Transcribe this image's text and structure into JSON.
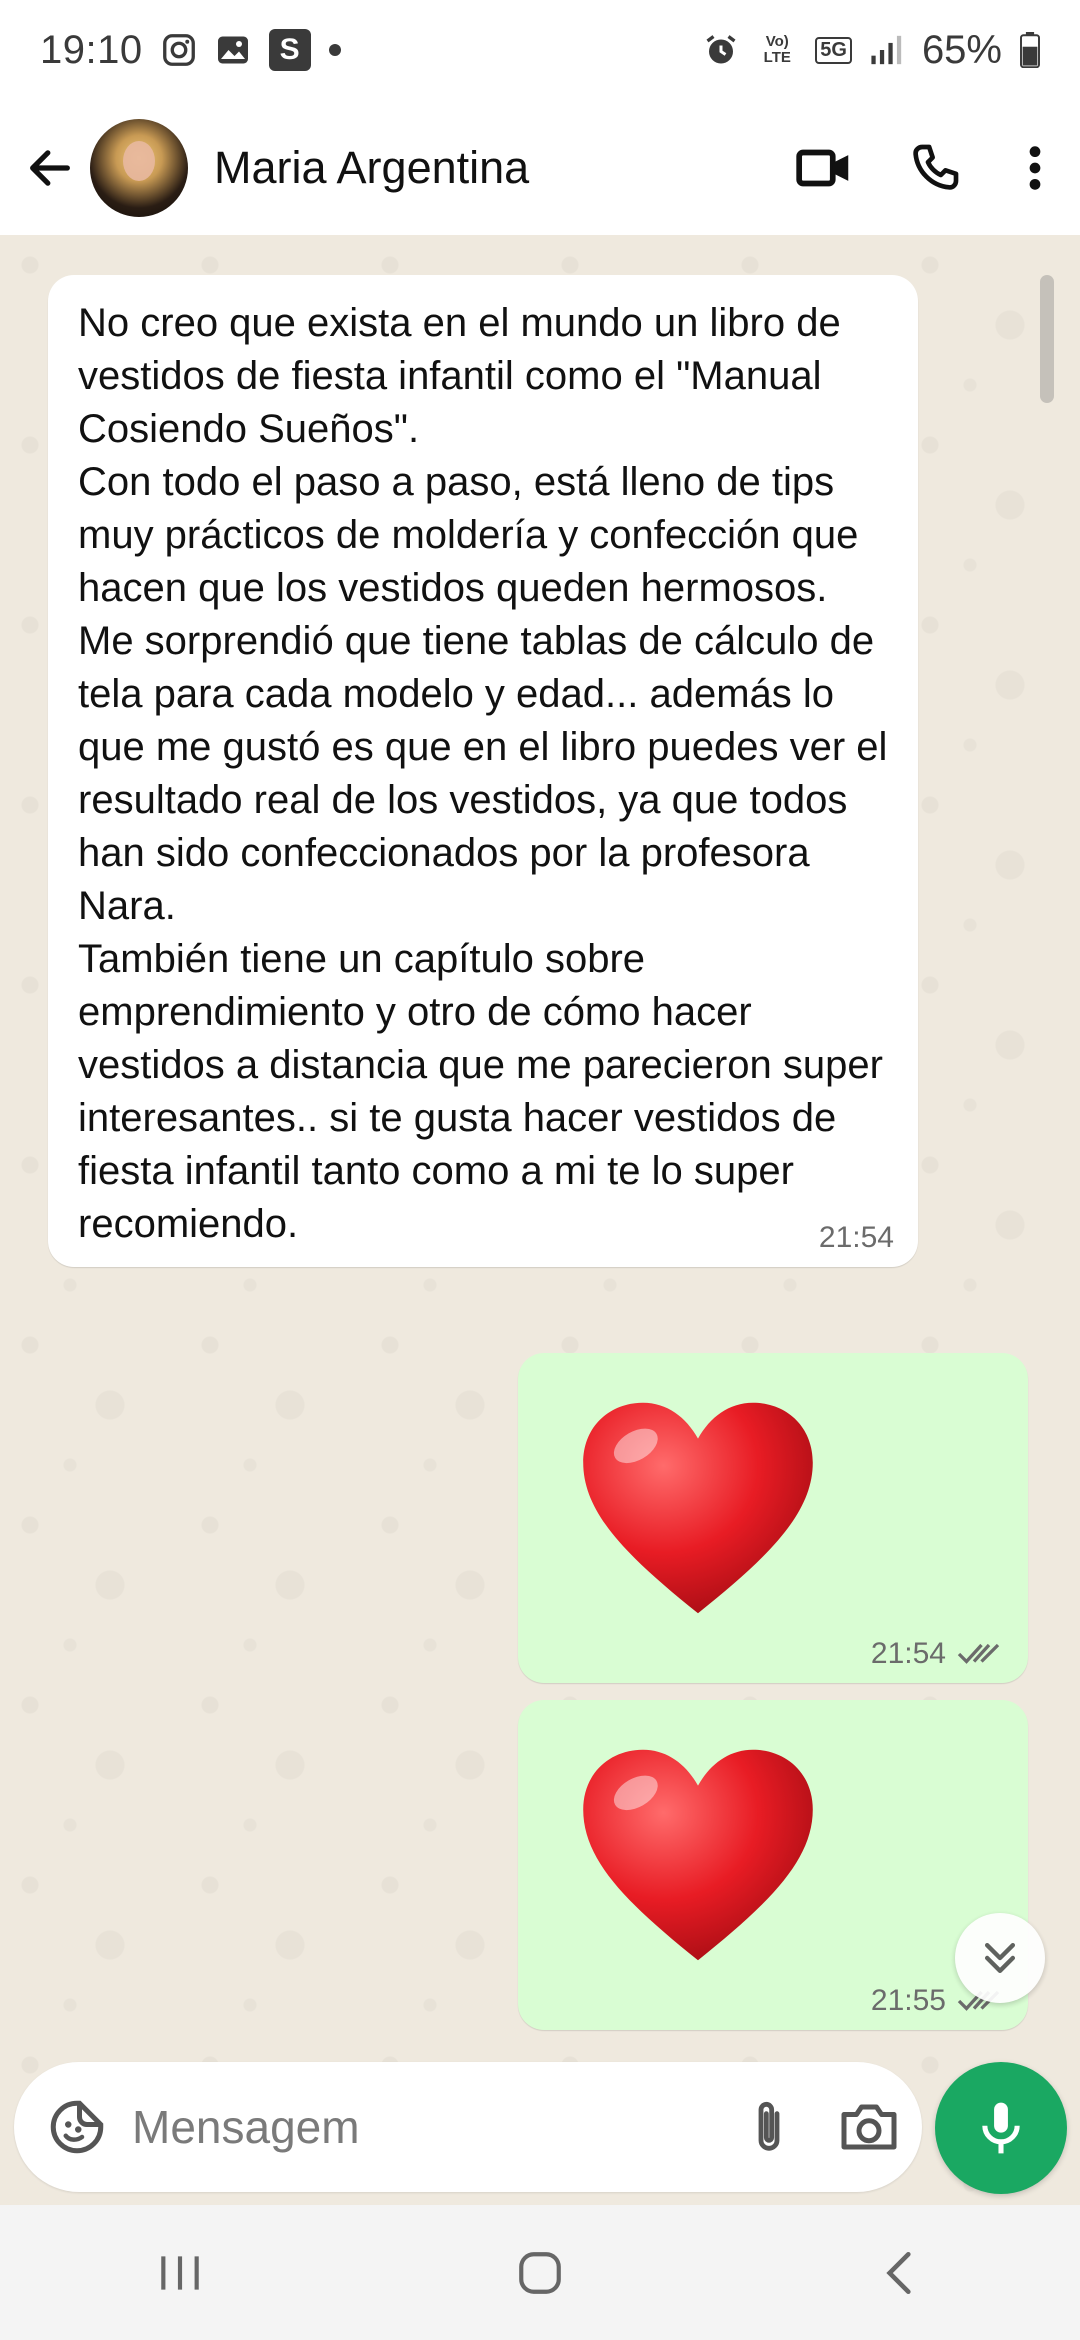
{
  "status_bar": {
    "time": "19:10",
    "battery": "65%",
    "icons": [
      "instagram-icon",
      "gallery-icon",
      "s-app-icon",
      "dot-icon",
      "alarm-icon",
      "volte-icon",
      "5g-icon",
      "signal-icon",
      "battery-icon"
    ],
    "volte_label": "Vo) LTE",
    "network_label": "5G",
    "s_app_label": "S"
  },
  "header": {
    "contact_name": "Maria Argentina",
    "icons": [
      "back-arrow-icon",
      "video-call-icon",
      "voice-call-icon",
      "more-vert-icon"
    ]
  },
  "messages": [
    {
      "direction": "incoming",
      "text": "No creo que exista en el mundo un libro de vestidos de fiesta infantil como el \"Manual Cosiendo Sueños\".\nCon todo el paso a paso, está lleno de tips muy prácticos de moldería y confección que hacen que los vestidos queden hermosos.\nMe sorprendió que tiene tablas de cálculo de tela para cada modelo y edad... además lo que me gustó es que en el libro puedes ver el resultado real de los vestidos, ya que todos han sido confeccionados por la profesora Nara.\nTambién tiene un capítulo sobre emprendimiento y otro de cómo hacer vestidos a distancia que me parecieron super interesantes.. si te gusta hacer vestidos de fiesta infantil tanto como a mi te lo super recomiendo.",
      "time": "21:54"
    },
    {
      "direction": "outgoing",
      "emoji": "red-heart",
      "time": "21:54",
      "status": "read"
    },
    {
      "direction": "outgoing",
      "emoji": "red-heart",
      "time": "21:55",
      "status": "read"
    }
  ],
  "composer": {
    "placeholder": "Mensagem",
    "icons": [
      "sticker-icon",
      "attach-clip-icon",
      "camera-icon",
      "microphone-icon"
    ]
  },
  "nav_bar": {
    "icons": [
      "recents-icon",
      "home-icon",
      "back-icon"
    ]
  },
  "colors": {
    "chat_background": "#efe9de",
    "incoming_bubble": "#ffffff",
    "outgoing_bubble": "#d9fdd3",
    "accent_green": "#1aa862",
    "read_ticks": "#6b6b6b"
  }
}
